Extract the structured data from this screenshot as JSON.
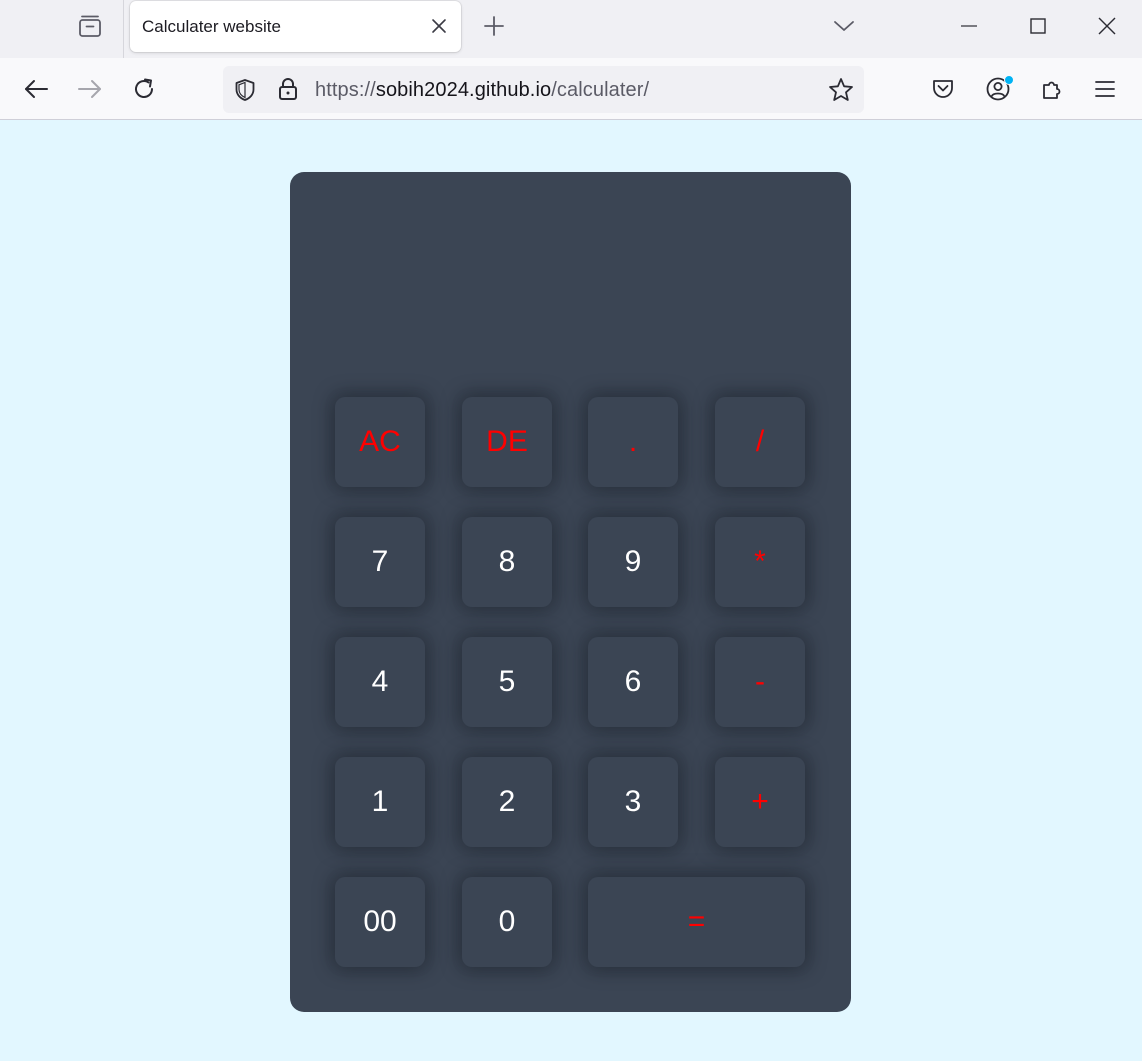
{
  "browser": {
    "tab": {
      "title": "Calculater website"
    },
    "url": {
      "prefix": "https://",
      "host": "sobih2024.github.io",
      "path": "/calculater/"
    },
    "colors": {
      "accent_dot": "#00b3f4"
    }
  },
  "calculator": {
    "display_value": "",
    "colors": {
      "body": "#3b4554",
      "page_background": "#e2f7ff",
      "digit_text": "#ffffff",
      "operator_text": "#ff0000"
    },
    "keys": {
      "ac": "AC",
      "de": "DE",
      "dot": ".",
      "divide": "/",
      "seven": "7",
      "eight": "8",
      "nine": "9",
      "multiply": "*",
      "four": "4",
      "five": "5",
      "six": "6",
      "minus": "-",
      "one": "1",
      "two": "2",
      "three": "3",
      "plus": "+",
      "double_zero": "00",
      "zero": "0",
      "equals": "="
    }
  }
}
